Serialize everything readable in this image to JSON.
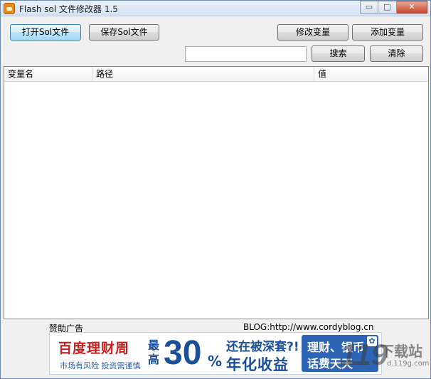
{
  "window": {
    "title": "Flash sol 文件修改器 1.5",
    "controls": {
      "minimize": "▭",
      "maximize": "□",
      "close": "✕"
    }
  },
  "toolbar": {
    "open_label": "打开Sol文件",
    "save_label": "保存Sol文件",
    "modify_label": "修改变量",
    "add_label": "添加变量",
    "search_label": "搜索",
    "clear_label": "清除"
  },
  "search": {
    "value": "",
    "placeholder": ""
  },
  "table": {
    "columns": [
      "变量名",
      "路径",
      "值"
    ],
    "rows": []
  },
  "footer": {
    "ad_label": "赞助广告",
    "blog": "BLOG:http://www.cordyblog.cn"
  },
  "banner": {
    "brand": "百度理财周",
    "subtitle": "市场有风险 投资需谨慎",
    "most": "最高",
    "number": "30",
    "percent": "%",
    "question": "还在被深套?!",
    "yield": "年化收益",
    "box_line1": "理财、银币",
    "box_line2": "话费天天",
    "icon": "paw-icon"
  },
  "watermark": {
    "logo": "119",
    "title": "下载站",
    "url": "d.119g.com"
  },
  "colors": {
    "title_bar": "#dbe6f4",
    "banner_blue": "#1a4f9c",
    "brand_red": "#c81e1e"
  }
}
